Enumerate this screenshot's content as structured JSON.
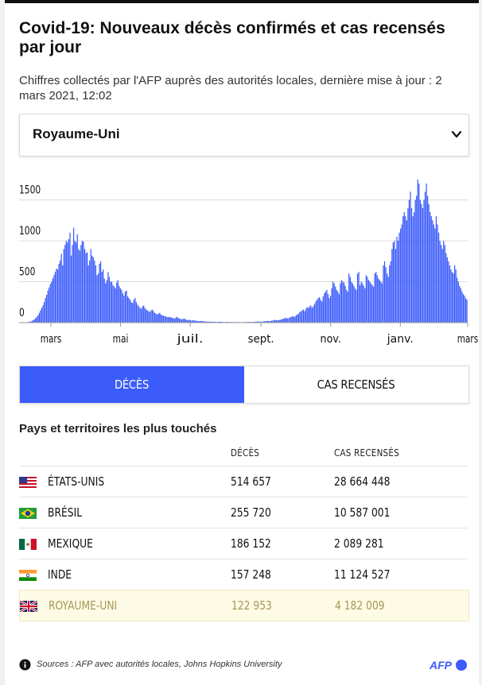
{
  "header": {
    "title": "Covid-19: Nouveaux décès confirmés et cas recensés par jour",
    "subtitle": "Chiffres collectés par l'AFP auprès des autorités locales, dernière mise à jour : 2 mars 2021, 12:02"
  },
  "country_select": {
    "selected": "Royaume-Uni"
  },
  "chart_data": {
    "type": "bar",
    "title": "",
    "x_ticks": [
      "mars",
      "mai",
      "juil.",
      "sept.",
      "nov.",
      "janv.",
      "mars"
    ],
    "y_ticks": [
      "1500",
      "1000",
      "500",
      "0"
    ],
    "ylim": [
      0,
      1700
    ],
    "grid": true,
    "color": "#3b5bfb",
    "series": [
      {
        "x_start": "2020-03-01",
        "x_end": "2021-03-01",
        "monthly_daily_deaths": {
          "2020-03": [
            0,
            0,
            0,
            0,
            1,
            2,
            5,
            8,
            10,
            15,
            20,
            30,
            40,
            55,
            70,
            90,
            120,
            150,
            180,
            210,
            250,
            300,
            340,
            390,
            430,
            470,
            500,
            540,
            580,
            620,
            660
          ],
          "2020-04": [
            650,
            720,
            760,
            840,
            700,
            900,
            950,
            1000,
            980,
            1020,
            1100,
            820,
            950,
            1160,
            1000,
            980,
            1080,
            900,
            880,
            950,
            1000,
            990,
            900,
            850,
            860,
            700,
            760,
            900,
            820,
            800
          ],
          "2020-05": [
            760,
            700,
            580,
            600,
            720,
            750,
            620,
            650,
            540,
            480,
            520,
            620,
            560,
            500,
            500,
            460,
            440,
            420,
            490,
            520,
            450,
            420,
            400,
            360,
            330,
            380,
            390,
            320,
            300,
            280,
            250
          ],
          "2020-06": [
            240,
            280,
            300,
            250,
            220,
            200,
            180,
            170,
            200,
            210,
            180,
            160,
            150,
            140,
            130,
            150,
            160,
            140,
            120,
            110,
            100,
            110,
            120,
            100,
            90,
            85,
            80,
            75,
            70,
            65
          ],
          "2020-07": [
            70,
            65,
            60,
            55,
            50,
            60,
            70,
            60,
            50,
            45,
            40,
            45,
            50,
            40,
            35,
            30,
            35,
            30,
            25,
            28,
            30,
            25,
            22,
            20,
            18,
            20,
            22,
            18,
            15,
            15,
            14
          ],
          "2020-08": [
            12,
            10,
            14,
            12,
            10,
            12,
            10,
            8,
            8,
            10,
            12,
            10,
            8,
            8,
            6,
            8,
            10,
            8,
            6,
            8,
            7,
            6,
            8,
            6,
            5,
            8,
            6,
            6,
            5,
            7,
            6
          ],
          "2020-09": [
            6,
            8,
            10,
            8,
            10,
            8,
            8,
            10,
            12,
            14,
            12,
            14,
            12,
            10,
            14,
            16,
            18,
            20,
            22,
            20,
            18,
            24,
            26,
            30,
            34,
            30,
            28,
            32,
            34,
            40
          ],
          "2020-10": [
            45,
            50,
            55,
            60,
            50,
            55,
            65,
            70,
            80,
            75,
            70,
            90,
            100,
            110,
            130,
            140,
            150,
            160,
            140,
            170,
            190,
            180,
            200,
            210,
            180,
            200,
            230,
            260,
            280,
            300,
            310
          ],
          "2020-11": [
            280,
            260,
            320,
            360,
            380,
            400,
            350,
            300,
            330,
            420,
            500,
            480,
            440,
            400,
            380,
            350,
            480,
            520,
            500,
            490,
            450,
            400,
            380,
            600,
            560,
            500,
            480,
            450,
            420,
            400
          ],
          "2020-12": [
            600,
            620,
            460,
            500,
            480,
            450,
            420,
            580,
            560,
            520,
            500,
            480,
            460,
            440,
            600,
            620,
            580,
            540,
            520,
            500,
            480,
            700,
            750,
            680,
            600,
            560,
            700,
            750,
            900,
            980,
            1000
          ],
          "2021-01": [
            900,
            1050,
            1000,
            1100,
            1150,
            1200,
            1300,
            1350,
            1300,
            1250,
            1400,
            1500,
            1600,
            1400,
            1300,
            1350,
            1500,
            1550,
            1750,
            1700,
            1500,
            1450,
            1400,
            1500,
            1600,
            1700,
            1550,
            1450,
            1350,
            1300,
            1250
          ],
          "2021-02": [
            1200,
            1150,
            1300,
            1200,
            1100,
            1000,
            950,
            900,
            1000,
            950,
            850,
            800,
            750,
            700,
            650,
            620,
            600,
            700,
            650,
            550,
            500,
            450,
            420,
            380,
            350,
            330,
            300,
            280
          ]
        }
      }
    ]
  },
  "tabs": {
    "deaths": "DÉCÈS",
    "cases": "CAS RECENSÉS"
  },
  "table": {
    "title": "Pays et territoires les plus touchés",
    "col_deaths": "DÉCÈS",
    "col_cases": "CAS RECENSÉS",
    "rows": [
      {
        "country": "ÉTATS-UNIS",
        "deaths": "514 657",
        "cases": "28 664 448",
        "flag": "us-flag"
      },
      {
        "country": "BRÉSIL",
        "deaths": "255 720",
        "cases": "10 587 001",
        "flag": "brazil-flag"
      },
      {
        "country": "MEXIQUE",
        "deaths": "186 152",
        "cases": "2 089 281",
        "flag": "mexico-flag"
      },
      {
        "country": "INDE",
        "deaths": "157 248",
        "cases": "11 124 527",
        "flag": "india-flag"
      },
      {
        "country": "ROYAUME-UNI",
        "deaths": "122 953",
        "cases": "4 182 009",
        "flag": "uk-flag"
      }
    ]
  },
  "footer": {
    "source": "Sources : AFP avec autorités locales, Johns Hopkins University",
    "logo": "AFP"
  },
  "colors": {
    "accent": "#3b5bfb",
    "highlight_bg": "#fdfbe6",
    "highlight_text": "#a89656"
  }
}
